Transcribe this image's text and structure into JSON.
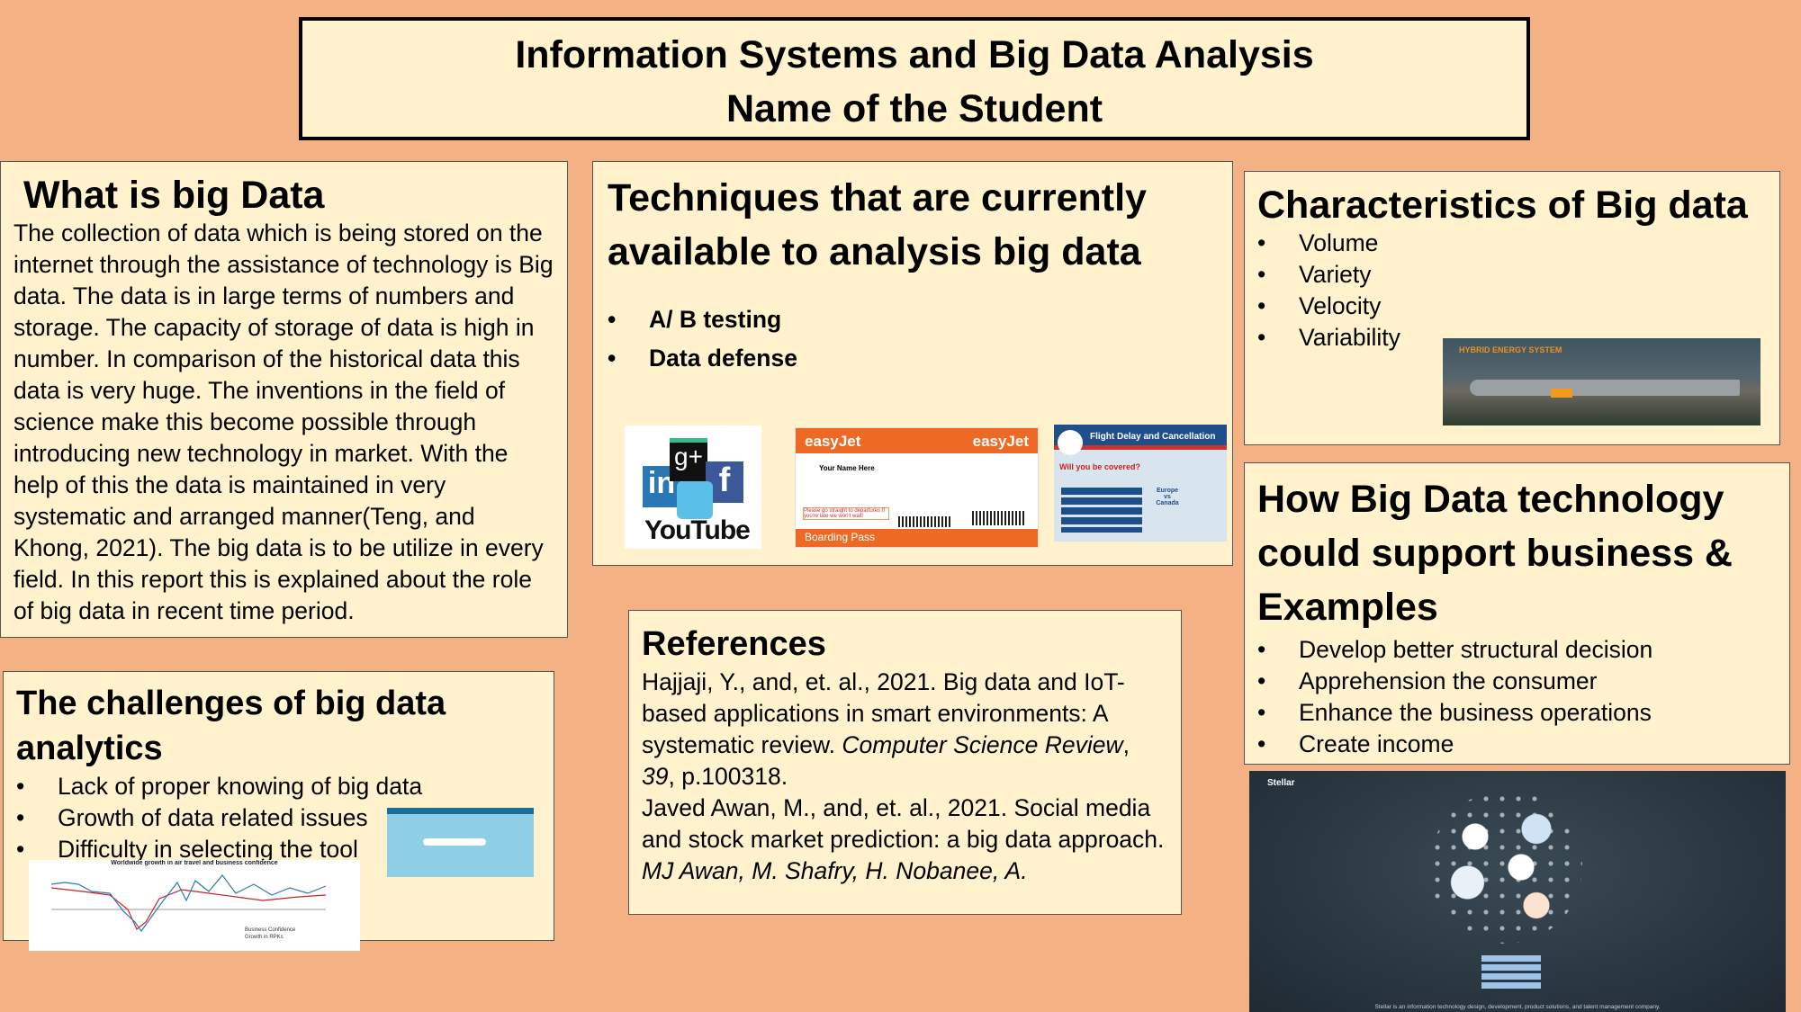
{
  "title": {
    "line1": "Information Systems and Big Data Analysis",
    "line2": "Name of the Student"
  },
  "what_is": {
    "heading": "What is big Data",
    "body": "The collection of data which is being stored on the internet through the assistance of technology is Big data. The data is in large terms of numbers and storage. The capacity of storage of data is high in number. In comparison of the historical data this data is very huge. The inventions in the field of science make this become possible through introducing new technology in market. With the help of this the data is maintained in very systematic and arranged manner(Teng,  and Khong,  2021). The big data is to be utilize in every field. In this report this is explained about the role of big data in recent time period."
  },
  "techniques": {
    "heading": "Techniques that are currently available to analysis big data",
    "items": [
      "A/ B testing",
      "Data defense"
    ],
    "images": {
      "social": [
        "g+",
        "in",
        "f",
        "YouTube"
      ],
      "boarding_pass": {
        "brand": "easyJet",
        "label": "Boarding Pass",
        "name": "Your Name Here",
        "note": "Please go straight to departures If you're late we won't wait!"
      },
      "flight_delay": {
        "title": "Flight Delay and Cancellation",
        "question": "Will you be covered?",
        "compare": "Europe vs Canada"
      }
    }
  },
  "characteristics": {
    "heading": "Characteristics of Big data",
    "items": [
      "Volume",
      "Variety",
      "Velocity",
      "Variability"
    ],
    "image_label": "HYBRID ENERGY SYSTEM"
  },
  "how": {
    "heading": "How Big Data technology could support business & Examples",
    "items": [
      "Develop better structural decision",
      "Apprehension the consumer",
      "Enhance the business operations",
      "Create income"
    ]
  },
  "challenges": {
    "heading": "The challenges of big data analytics",
    "items": [
      "Lack of proper knowing of big data",
      "Growth of data related issues",
      "Difficulty in selecting the tool"
    ],
    "chart_title": "Worldwide growth in air travel and business confidence",
    "chart_legend": [
      "Business Confidence",
      "Growth in RPKs"
    ]
  },
  "references": {
    "heading": "References",
    "ref1_plain": "Hajjaji, Y., and, et. al., 2021. Big data and IoT-based applications in smart environments: A systematic review. ",
    "ref1_journal": "Computer Science Review",
    "ref1_vol": "39",
    "ref1_end": ", p.100318.",
    "ref2_plain": "Javed Awan, M., and, et. al., 2021. Social media and stock market prediction: a big data approach. ",
    "ref2_italic": "MJ Awan, M. Shafry, H. Nobanee, A."
  },
  "bulb_image": {
    "brand": "Stellar",
    "caption": "Stellar is an information technology design, development, product solutions, and talent management company."
  },
  "colors": {
    "background": "#f4b183",
    "panel": "#fff2cc"
  }
}
